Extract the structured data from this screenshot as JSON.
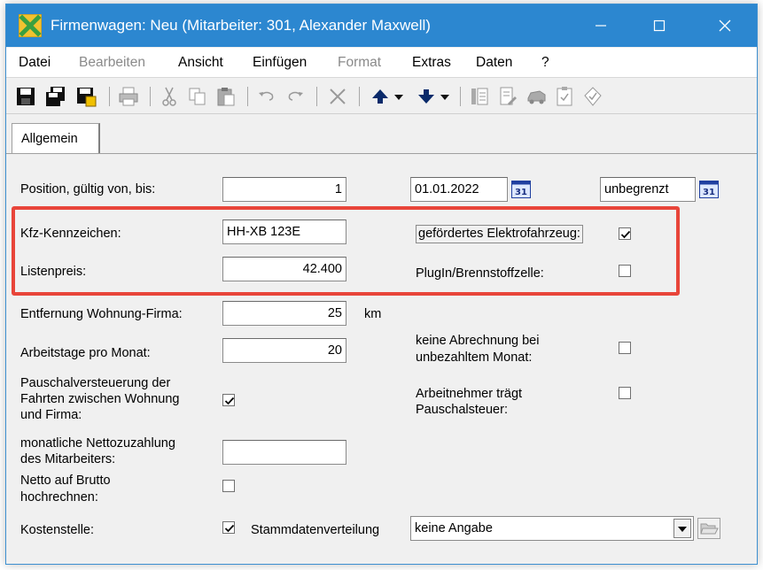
{
  "window": {
    "title": "Firmenwagen: Neu (Mitarbeiter: 301, Alexander Maxwell)",
    "accent": "#2c87d0",
    "highlight_color": "#e8453a"
  },
  "menu": {
    "items": [
      {
        "label": "Datei",
        "enabled": true
      },
      {
        "label": "Bearbeiten",
        "enabled": false
      },
      {
        "label": "Ansicht",
        "enabled": true
      },
      {
        "label": "Einfügen",
        "enabled": true
      },
      {
        "label": "Format",
        "enabled": false
      },
      {
        "label": "Extras",
        "enabled": true
      },
      {
        "label": "Daten",
        "enabled": true
      },
      {
        "label": "?",
        "enabled": true
      }
    ]
  },
  "toolbar": {
    "icons": [
      "save-icon",
      "save-close-icon",
      "save-new-icon",
      "print-icon",
      "cut-icon",
      "copy-icon",
      "paste-icon",
      "undo-icon",
      "redo-icon",
      "delete-icon",
      "move-up-icon",
      "move-down-icon",
      "document-icon",
      "document-edit-icon",
      "vehicle-icon",
      "checklist-icon",
      "approve-icon"
    ]
  },
  "tabs": [
    {
      "label": "Allgemein",
      "active": true
    }
  ],
  "form": {
    "position_label": "Position, gültig von, bis:",
    "position_value": "1",
    "valid_from": "01.01.2022",
    "valid_to": "unbegrenzt",
    "calendar_label": "31",
    "plate_label": "Kfz-Kennzeichen:",
    "plate_value": "HH-XB 123E",
    "electric_label": "gefördertes Elektrofahrzeug:",
    "electric_checked": true,
    "list_price_label": "Listenpreis:",
    "list_price_value": "42.400",
    "plugin_label": "PlugIn/Brennstoffzelle:",
    "plugin_checked": false,
    "distance_label": "Entfernung Wohnung-Firma:",
    "distance_value": "25",
    "distance_unit": "km",
    "workdays_label": "Arbeitstage pro Monat:",
    "workdays_value": "20",
    "no_billing_label_1": "keine Abrechnung bei",
    "no_billing_label_2": "unbezahltem Monat:",
    "no_billing_checked": false,
    "flat_tax_label_1": "Pauschalversteuerung der",
    "flat_tax_label_2": "Fahrten zwischen Wohnung",
    "flat_tax_label_3": "und Firma:",
    "flat_tax_checked": true,
    "employee_tax_label_1": "Arbeitnehmer trägt",
    "employee_tax_label_2": "Pauschalsteuer:",
    "employee_tax_checked": false,
    "net_payment_label_1": "monatliche Nettozuzahlung",
    "net_payment_label_2": "des Mitarbeiters:",
    "net_payment_value": "",
    "gross_up_label_1": "Netto auf Brutto",
    "gross_up_label_2": "hochrechnen:",
    "gross_up_checked": false,
    "cost_center_label": "Kostenstelle:",
    "cost_center_checked": true,
    "distribution_label": "Stammdatenverteilung",
    "distribution_value": "keine Angabe"
  }
}
